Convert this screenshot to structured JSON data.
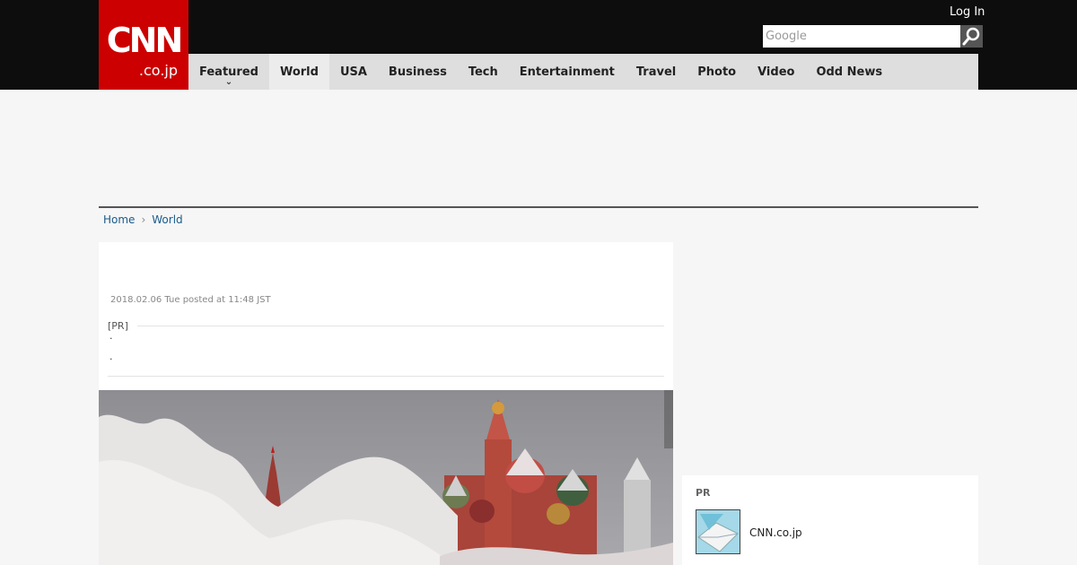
{
  "header": {
    "logo_main": "CNN",
    "logo_sub": ".co.jp",
    "login_label": "Log In",
    "search_placeholder": "Google"
  },
  "nav": {
    "items": [
      {
        "label": "Featured"
      },
      {
        "label": "World"
      },
      {
        "label": "USA"
      },
      {
        "label": "Business"
      },
      {
        "label": "Tech"
      },
      {
        "label": "Entertainment"
      },
      {
        "label": "Travel"
      },
      {
        "label": "Photo"
      },
      {
        "label": "Video"
      },
      {
        "label": "Odd News"
      }
    ]
  },
  "breadcrumb": {
    "items": [
      "Home",
      "World"
    ]
  },
  "article": {
    "dateline": "2018.02.06 Tue posted at 11:48 JST",
    "pr_label": "[PR]",
    "pr_items": [
      "·",
      "·"
    ]
  },
  "sidebar": {
    "pr_title": "PR",
    "link_label": "CNN.co.jp"
  },
  "colors": {
    "brand_red": "#cc0000",
    "topbar": "#0d0d0d",
    "nav_bg": "#dedede",
    "link": "#1a5b8a"
  }
}
